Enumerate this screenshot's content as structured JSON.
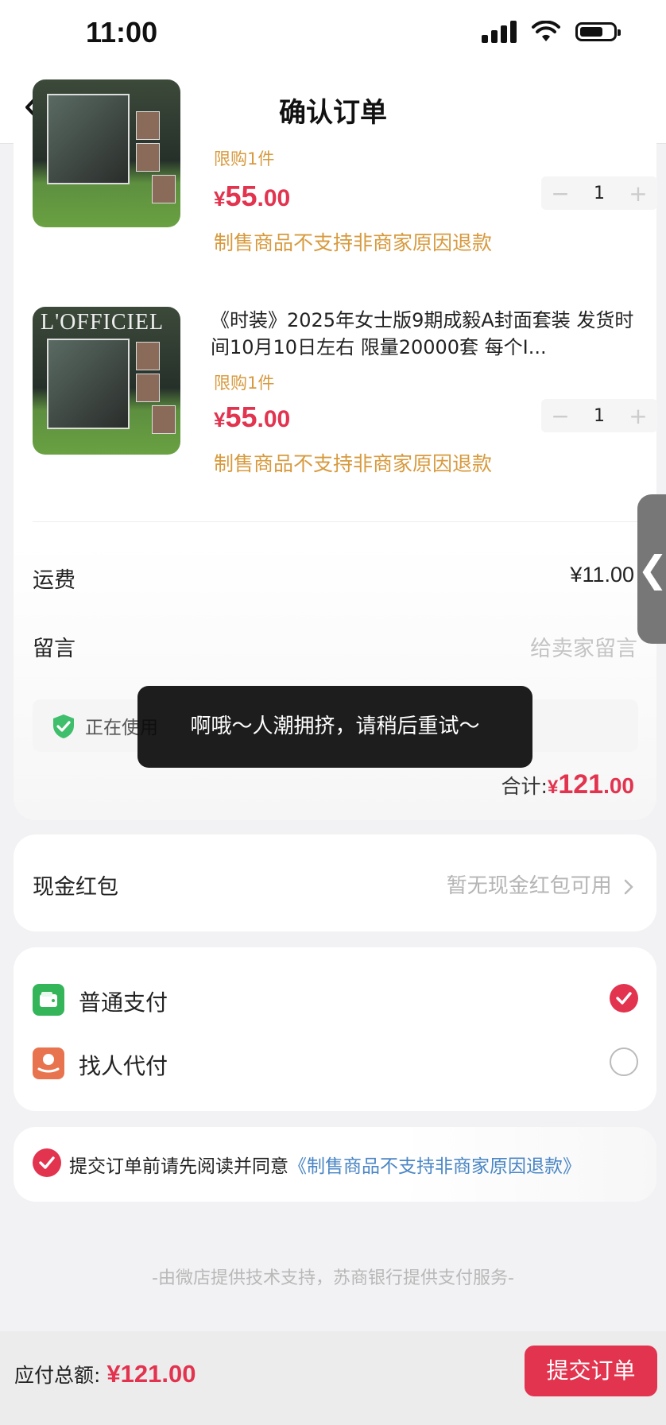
{
  "status_bar": {
    "time": "11:00"
  },
  "nav": {
    "title": "确认订单"
  },
  "products": [
    {
      "title": "",
      "limit": "限购1件",
      "price_currency": "¥",
      "price_int": "55",
      "price_dec": ".00",
      "quantity": "1",
      "refund_note": "制售商品不支持非商家原因退款"
    },
    {
      "title": "《时装》2025年女士版9期成毅A封面套装 发货时间10月10日左右 限量20000套 每个I...",
      "limit": "限购1件",
      "price_currency": "¥",
      "price_int": "55",
      "price_dec": ".00",
      "quantity": "1",
      "refund_note": "制售商品不支持非商家原因退款"
    }
  ],
  "shipping": {
    "label": "运费",
    "value": "¥11.00"
  },
  "message": {
    "label": "留言",
    "placeholder": "给卖家留言"
  },
  "secure_bar": {
    "text": "正在使用"
  },
  "subtotal": {
    "label": "合计:",
    "currency": "¥",
    "int": "121",
    "dec": ".00"
  },
  "toast": {
    "text": "啊哦～人潮拥挤，请稍后重试～"
  },
  "side_tab": {
    "glyph": "❮"
  },
  "red_packet": {
    "label": "现金红包",
    "value": "暂无现金红包可用"
  },
  "payment": {
    "options": [
      {
        "label": "普通支付",
        "selected": true,
        "icon": "wallet-icon",
        "color": "#34b55a"
      },
      {
        "label": "找人代付",
        "selected": false,
        "icon": "hand-coin-icon",
        "color": "#e8744f"
      }
    ]
  },
  "agreement": {
    "text": "提交订单前请先阅读并同意",
    "link": "《制售商品不支持非商家原因退款》"
  },
  "footer_note": "-由微店提供技术支持，苏商银行提供支付服务-",
  "bottom": {
    "label": "应付总额:",
    "amount": "¥121.00",
    "submit": "提交订单"
  },
  "colors": {
    "accent": "#e2334f",
    "warn": "#d79a3e",
    "link": "#4a86c5"
  }
}
